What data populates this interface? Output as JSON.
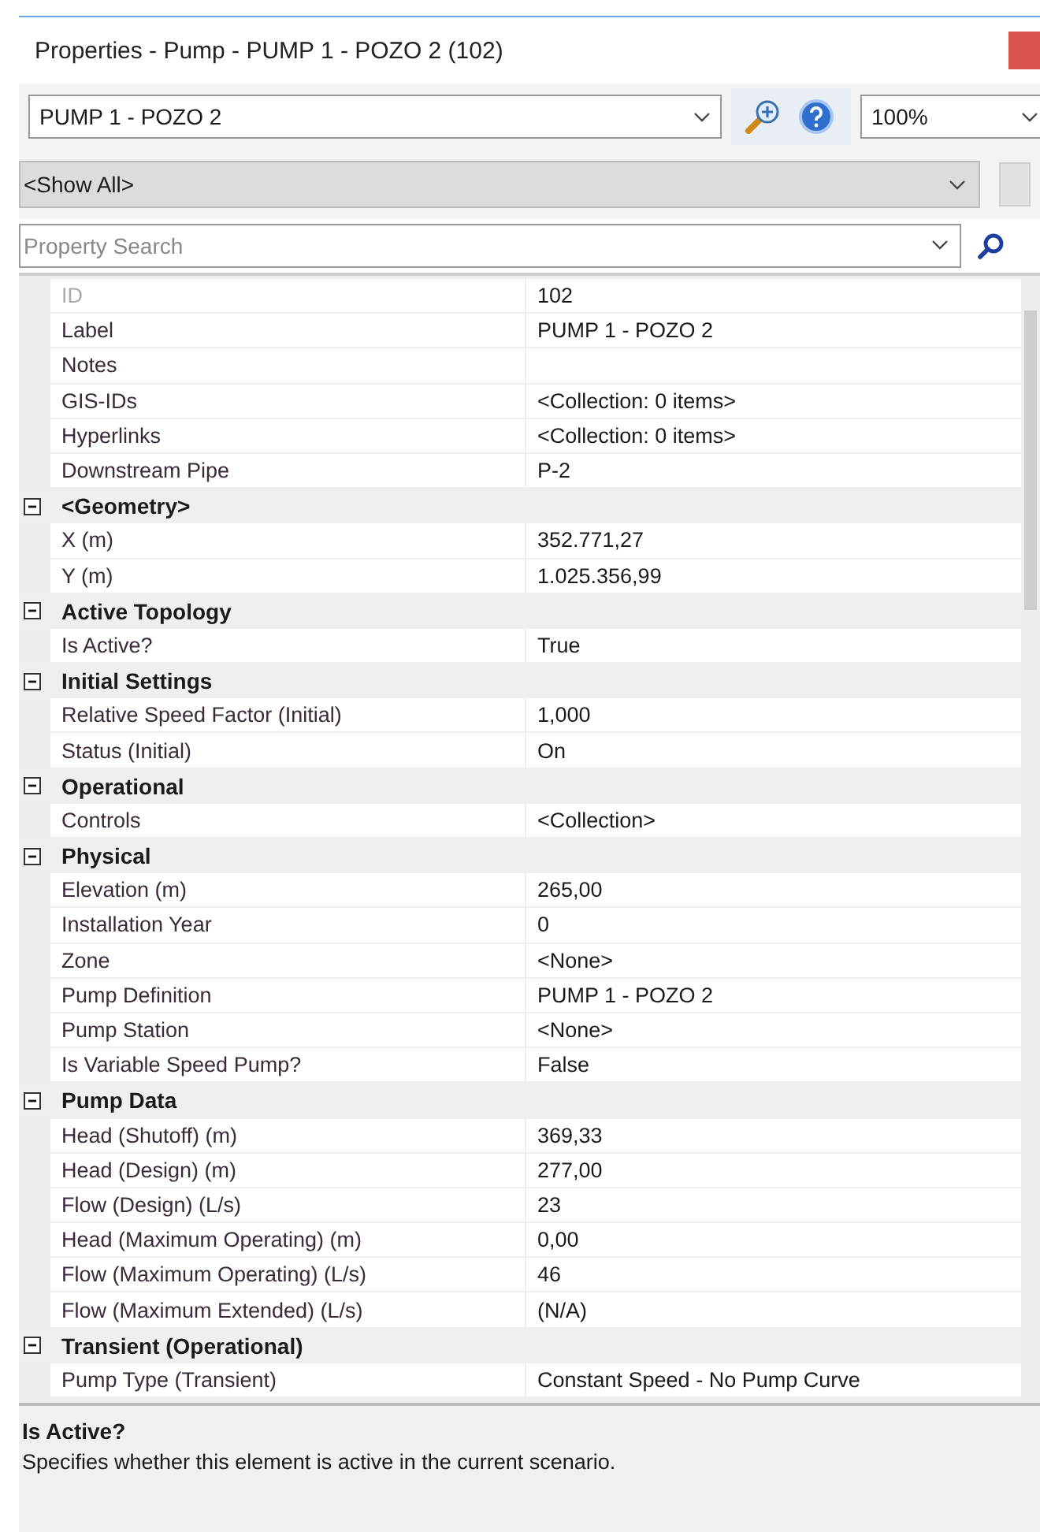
{
  "window": {
    "title": "Properties - Pump - PUMP 1 - POZO 2 (102)"
  },
  "toolbar": {
    "element_select": {
      "value": "PUMP 1 - POZO 2"
    },
    "zoom_select": {
      "value": "100%"
    }
  },
  "filter": {
    "value": "<Show All>"
  },
  "search": {
    "placeholder": "Property Search"
  },
  "grid": {
    "rows": [
      {
        "kind": "property",
        "name": "ID",
        "value": "102",
        "disabled": true
      },
      {
        "kind": "property",
        "name": "Label",
        "value": "PUMP 1 - POZO 2",
        "disabled": false
      },
      {
        "kind": "property",
        "name": "Notes",
        "disabled": false
      },
      {
        "kind": "property",
        "name": "GIS-IDs",
        "value": "<Collection: 0 items>",
        "disabled": false
      },
      {
        "kind": "property",
        "name": "Hyperlinks",
        "value": "<Collection: 0 items>",
        "disabled": false
      },
      {
        "kind": "property",
        "name": "Downstream Pipe",
        "value": "P-2",
        "disabled": false
      },
      {
        "kind": "category",
        "label": "<Geometry>",
        "expanded": true
      },
      {
        "kind": "property",
        "name": "X (m)",
        "value": "352.771,27",
        "disabled": false
      },
      {
        "kind": "property",
        "name": "Y (m)",
        "value": "1.025.356,99",
        "disabled": false
      },
      {
        "kind": "category",
        "label": "Active Topology",
        "expanded": true
      },
      {
        "kind": "property",
        "name": "Is Active?",
        "value": "True",
        "disabled": false
      },
      {
        "kind": "category",
        "label": "Initial Settings",
        "expanded": true
      },
      {
        "kind": "property",
        "name": "Relative Speed Factor (Initial)",
        "value": "1,000",
        "disabled": false
      },
      {
        "kind": "property",
        "name": "Status (Initial)",
        "value": "On",
        "disabled": false
      },
      {
        "kind": "category",
        "label": "Operational",
        "expanded": true
      },
      {
        "kind": "property",
        "name": "Controls",
        "value": "<Collection>",
        "disabled": false
      },
      {
        "kind": "category",
        "label": "Physical",
        "expanded": true
      },
      {
        "kind": "property",
        "name": "Elevation (m)",
        "value": "265,00",
        "disabled": false
      },
      {
        "kind": "property",
        "name": "Installation Year",
        "value": "0",
        "disabled": false
      },
      {
        "kind": "property",
        "name": "Zone",
        "value": "<None>",
        "disabled": false
      },
      {
        "kind": "property",
        "name": "Pump Definition",
        "value": "PUMP 1 - POZO 2",
        "disabled": false
      },
      {
        "kind": "property",
        "name": "Pump Station",
        "value": "<None>",
        "disabled": false
      },
      {
        "kind": "property",
        "name": "Is Variable Speed Pump?",
        "value": "False",
        "disabled": false
      },
      {
        "kind": "category",
        "label": "Pump Data",
        "expanded": true
      },
      {
        "kind": "property",
        "name": "Head (Shutoff) (m)",
        "value": "369,33",
        "disabled": false
      },
      {
        "kind": "property",
        "name": "Head (Design) (m)",
        "value": "277,00",
        "disabled": false
      },
      {
        "kind": "property",
        "name": "Flow (Design) (L/s)",
        "value": "23",
        "disabled": false
      },
      {
        "kind": "property",
        "name": "Head (Maximum Operating) (m)",
        "value": "0,00",
        "disabled": false
      },
      {
        "kind": "property",
        "name": "Flow (Maximum Operating) (L/s)",
        "value": "46",
        "disabled": false
      },
      {
        "kind": "property",
        "name": "Flow (Maximum Extended) (L/s)",
        "value": "(N/A)",
        "disabled": false
      },
      {
        "kind": "category",
        "label": "Transient (Operational)",
        "expanded": true
      },
      {
        "kind": "property",
        "name": "Pump Type (Transient)",
        "value": "Constant Speed - No Pump Curve",
        "disabled": false
      }
    ]
  },
  "description": {
    "title": "Is Active?",
    "text": "Specifies whether this element is active in the current scenario."
  }
}
